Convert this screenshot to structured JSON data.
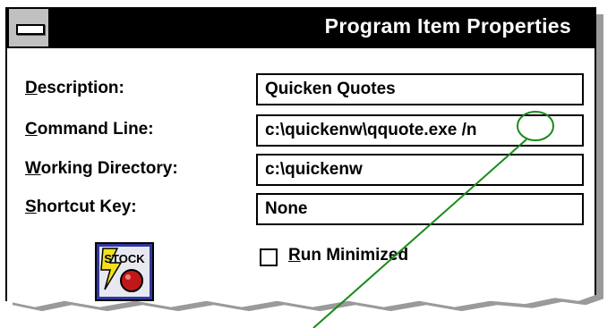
{
  "window": {
    "title": "Program Item Properties"
  },
  "fields": {
    "description": {
      "label_accel": "D",
      "label_rest": "escription:",
      "value": "Quicken Quotes"
    },
    "command_line": {
      "label_accel": "C",
      "label_rest": "ommand Line:",
      "value": "c:\\quickenw\\qquote.exe /n"
    },
    "working_directory": {
      "label_accel": "W",
      "label_rest": "orking Directory:",
      "value": "c:\\quickenw"
    },
    "shortcut_key": {
      "label_accel": "S",
      "label_rest": "hortcut Key:",
      "value": "None"
    }
  },
  "run_minimized": {
    "label_accel": "R",
    "label_rest": "un Minimized",
    "checked": false
  },
  "program_icon": {
    "name": "stock-icon",
    "text": "STOCK"
  },
  "colors": {
    "annotation": "#1a8a1a",
    "title_bg": "#000000",
    "icon_bg": "#3038a0",
    "icon_bolt": "#f0e020",
    "icon_ball": "#c01818"
  }
}
